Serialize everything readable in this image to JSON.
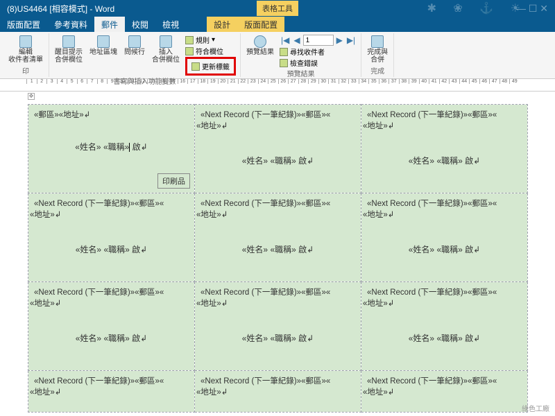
{
  "title": "(8)US4464 [相容模式] - Word",
  "tooltab": "表格工具",
  "tabs": [
    "版面配置",
    "參考資料",
    "郵件",
    "校閱",
    "檢視"
  ],
  "tooltabs": [
    "設計",
    "版面配置"
  ],
  "active_tab": "郵件",
  "ribbon": {
    "g1_name": "",
    "edit": "編輯\n收件者清單",
    "print": "印",
    "g2": {
      "a": "醒目提示\n合併欄位",
      "b": "地址區塊",
      "c": "問候行",
      "d": "插入\n合併欄位",
      "name": "書寫與插入功能變數"
    },
    "rules": "規則",
    "match": "符合欄位",
    "update": "更新標籤",
    "preview": "預覽結果",
    "preview_name": "預覽結果",
    "nav_val": "1",
    "find": "尋找收件者",
    "check": "檢查錯誤",
    "finish": "完成與\n合併",
    "finish_name": "完成"
  },
  "fields": {
    "zip": "«郵區»",
    "addr": "«地址»",
    "name": "«姓名»",
    "title": "«職稱»",
    "open": "啟",
    "next": "«Next Record (下一筆紀錄)»",
    "print": "印刷品"
  },
  "watermark": "綠色工廠"
}
